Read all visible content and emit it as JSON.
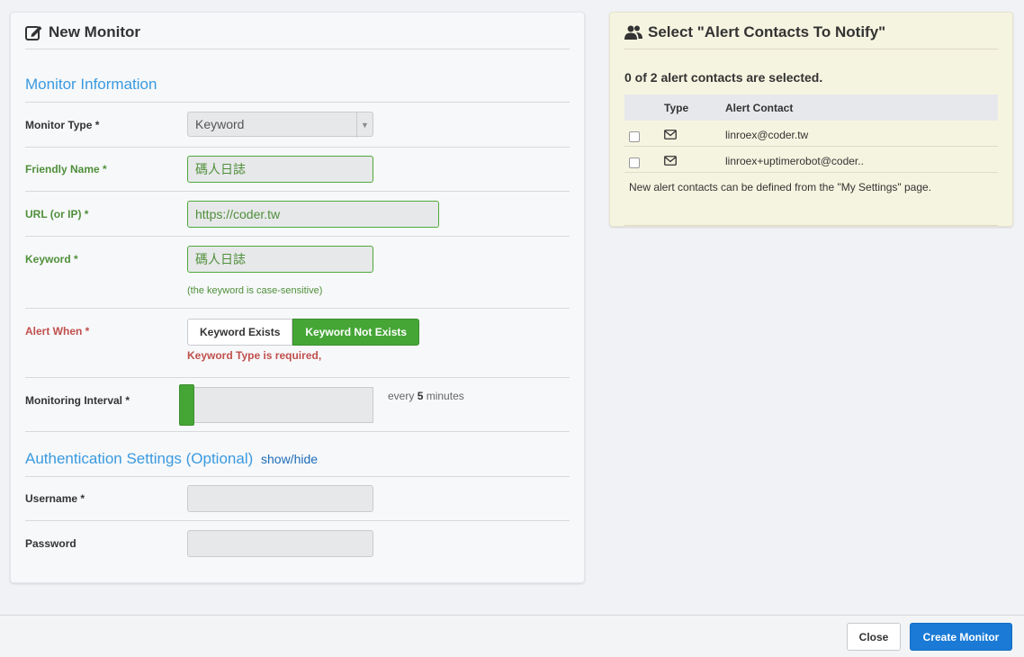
{
  "monitor": {
    "title": "New Monitor",
    "section_info": "Monitor Information",
    "monitor_type_label": "Monitor Type *",
    "monitor_type_value": "Keyword",
    "friendly_name_label": "Friendly Name *",
    "friendly_name_value": "碼人日誌",
    "url_label": "URL (or IP) *",
    "url_value": "https://coder.tw",
    "keyword_label": "Keyword *",
    "keyword_value": "碼人日誌",
    "keyword_help": "(the keyword is case-sensitive)",
    "alert_when_label": "Alert When *",
    "alert_options": [
      "Keyword Exists",
      "Keyword Not Exists"
    ],
    "alert_selected": "Keyword Not Exists",
    "alert_error": "Keyword Type is required,",
    "interval_label": "Monitoring Interval *",
    "interval_prefix": "every",
    "interval_value": "5",
    "interval_suffix": "minutes",
    "auth_section": "Authentication Settings (Optional)",
    "auth_toggle": "show/hide",
    "username_label": "Username *",
    "password_label": "Password"
  },
  "contacts": {
    "title": "Select \"Alert Contacts To Notify\"",
    "summary": "0 of 2 alert contacts are selected.",
    "col_type": "Type",
    "col_contact": "Alert Contact",
    "rows": [
      {
        "type_icon": "envelope-icon",
        "contact": "linroex@coder.tw"
      },
      {
        "type_icon": "envelope-icon",
        "contact": "linroex+uptimerobot@coder.."
      }
    ],
    "note": "New alert contacts can be defined from the \"My Settings\" page."
  },
  "footer": {
    "close_label": "Close",
    "create_label": "Create Monitor"
  },
  "colors": {
    "accent_blue": "#3a9ae0",
    "success_green": "#45a636",
    "error_red": "#c0504d",
    "primary_button": "#1a7ad6"
  }
}
